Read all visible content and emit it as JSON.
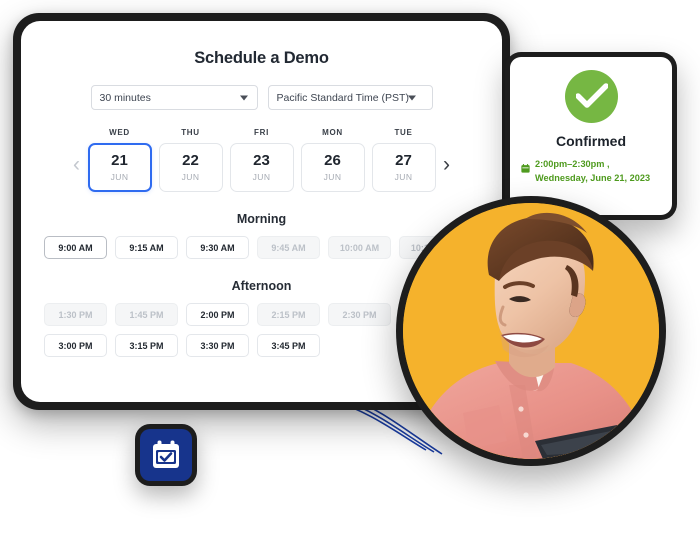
{
  "scheduler": {
    "title": "Schedule a Demo",
    "duration_select": {
      "value": "30 minutes",
      "icon": "chevron-down-icon"
    },
    "timezone_select": {
      "value": "Pacific Standard Time (PST)",
      "icon": "chevron-down-icon"
    },
    "nav": {
      "prev": "‹",
      "next": "›"
    },
    "dates": [
      {
        "dow": "WED",
        "day": "21",
        "month": "JUN",
        "selected": true
      },
      {
        "dow": "THU",
        "day": "22",
        "month": "JUN",
        "selected": false
      },
      {
        "dow": "FRI",
        "day": "23",
        "month": "JUN",
        "selected": false
      },
      {
        "dow": "MON",
        "day": "26",
        "month": "JUN",
        "selected": false
      },
      {
        "dow": "TUE",
        "day": "27",
        "month": "JUN",
        "selected": false
      }
    ],
    "morning": {
      "heading": "Morning",
      "slots": [
        {
          "label": "9:00 AM",
          "state": "available"
        },
        {
          "label": "9:15 AM",
          "state": "available"
        },
        {
          "label": "9:30 AM",
          "state": "available"
        },
        {
          "label": "9:45 AM",
          "state": "disabled"
        },
        {
          "label": "10:00 AM",
          "state": "disabled"
        },
        {
          "label": "10:15 AM",
          "state": "disabled"
        }
      ]
    },
    "afternoon": {
      "heading": "Afternoon",
      "slots_row1": [
        {
          "label": "1:30 PM",
          "state": "disabled"
        },
        {
          "label": "1:45 PM",
          "state": "disabled"
        },
        {
          "label": "2:00 PM",
          "state": "available"
        },
        {
          "label": "2:15 PM",
          "state": "disabled"
        },
        {
          "label": "2:30 PM",
          "state": "disabled"
        },
        {
          "label": "",
          "state": "disabled"
        }
      ],
      "slots_row2": [
        {
          "label": "3:00 PM",
          "state": "available"
        },
        {
          "label": "3:15 PM",
          "state": "available"
        },
        {
          "label": "3:30 PM",
          "state": "available"
        },
        {
          "label": "3:45 PM",
          "state": "available"
        }
      ]
    }
  },
  "confirmation": {
    "icon": "check-circle-icon",
    "title": "Confirmed",
    "detail_icon": "calendar-icon",
    "time_range": "2:00pm–2:30pm ,",
    "date_line": "Wednesday, June 21, 2023"
  },
  "app_icon": {
    "name": "calendar-check-icon"
  },
  "photo": {
    "name": "person-portrait"
  },
  "colors": {
    "accent_blue": "#2f6bf0",
    "blue_accent_shape": "#5b84ec",
    "confirm_green": "#76b743",
    "confirm_text_green": "#4f9b1f",
    "photo_bg_yellow": "#f5b22c",
    "app_icon_navy": "#17348c",
    "frame_dark": "#1d1d1d"
  }
}
